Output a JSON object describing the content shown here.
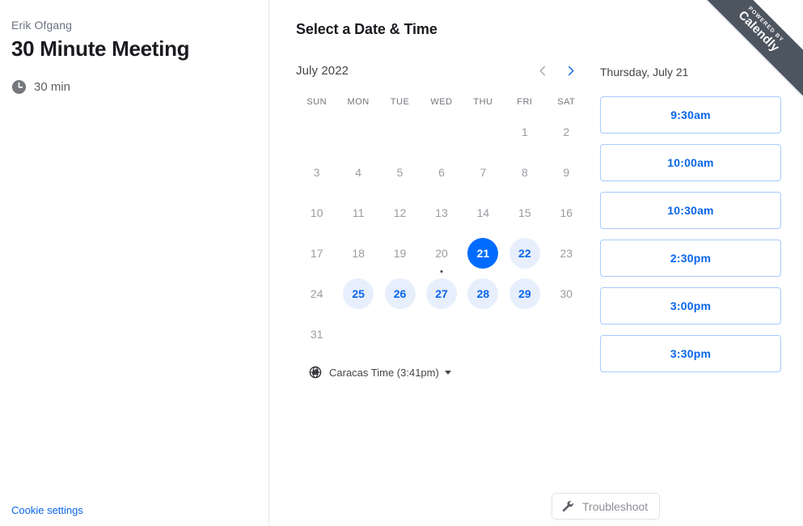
{
  "event": {
    "host_name": "Erik Ofgang",
    "title": "30 Minute Meeting",
    "duration": "30 min",
    "clock_icon": "clock-icon"
  },
  "footer": {
    "cookie_settings": "Cookie settings",
    "troubleshoot": "Troubleshoot",
    "wrench_icon": "wrench-icon"
  },
  "booking": {
    "section_title": "Select a Date & Time"
  },
  "calendar": {
    "month_label": "July 2022",
    "prev_label": "Previous month",
    "next_label": "Next month",
    "prev_enabled": false,
    "next_enabled": true,
    "weekdays": [
      "SUN",
      "MON",
      "TUE",
      "WED",
      "THU",
      "FRI",
      "SAT"
    ],
    "leading_blanks": 5,
    "days": [
      {
        "num": "1",
        "state": "disabled"
      },
      {
        "num": "2",
        "state": "disabled"
      },
      {
        "num": "3",
        "state": "disabled"
      },
      {
        "num": "4",
        "state": "disabled"
      },
      {
        "num": "5",
        "state": "disabled"
      },
      {
        "num": "6",
        "state": "disabled"
      },
      {
        "num": "7",
        "state": "disabled"
      },
      {
        "num": "8",
        "state": "disabled"
      },
      {
        "num": "9",
        "state": "disabled"
      },
      {
        "num": "10",
        "state": "disabled"
      },
      {
        "num": "11",
        "state": "disabled"
      },
      {
        "num": "12",
        "state": "disabled"
      },
      {
        "num": "13",
        "state": "disabled"
      },
      {
        "num": "14",
        "state": "disabled"
      },
      {
        "num": "15",
        "state": "disabled"
      },
      {
        "num": "16",
        "state": "disabled"
      },
      {
        "num": "17",
        "state": "disabled"
      },
      {
        "num": "18",
        "state": "disabled"
      },
      {
        "num": "19",
        "state": "disabled"
      },
      {
        "num": "20",
        "state": "disabled",
        "today": true
      },
      {
        "num": "21",
        "state": "selected"
      },
      {
        "num": "22",
        "state": "available"
      },
      {
        "num": "23",
        "state": "disabled"
      },
      {
        "num": "24",
        "state": "disabled"
      },
      {
        "num": "25",
        "state": "available"
      },
      {
        "num": "26",
        "state": "available"
      },
      {
        "num": "27",
        "state": "available"
      },
      {
        "num": "28",
        "state": "available"
      },
      {
        "num": "29",
        "state": "available"
      },
      {
        "num": "30",
        "state": "disabled"
      },
      {
        "num": "31",
        "state": "disabled"
      }
    ],
    "timezone": {
      "label": "Caracas Time (3:41pm)",
      "globe_icon": "globe-icon"
    }
  },
  "slots": {
    "selected_date_label": "Thursday, July 21",
    "times": [
      "9:30am",
      "10:00am",
      "10:30am",
      "2:30pm",
      "3:00pm",
      "3:30pm"
    ]
  },
  "ribbon": {
    "small_text": "POWERED BY",
    "brand": "Calendly"
  },
  "colors": {
    "accent_blue": "#006bff",
    "link_blue": "#0a66e8",
    "available_bg": "#e7effc",
    "slot_border": "#a7cbfb",
    "ribbon_bg": "#4d5560",
    "muted_text": "#9a9ca2"
  }
}
